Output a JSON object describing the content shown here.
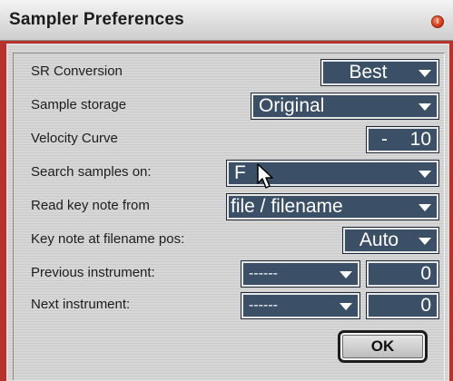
{
  "window": {
    "title": "Sampler Preferences"
  },
  "rows": {
    "sr_conversion": {
      "label": "SR Conversion",
      "value": "Best"
    },
    "sample_storage": {
      "label": "Sample storage",
      "value": "Original"
    },
    "velocity_curve": {
      "label": "Velocity Curve",
      "sign": "-",
      "value": "10"
    },
    "search_samples_on": {
      "label": "Search samples on:",
      "value": "F"
    },
    "read_key_note_from": {
      "label": "Read key note from",
      "value": "file / filename"
    },
    "key_note_pos": {
      "label": "Key note at filename pos:",
      "value": "Auto"
    },
    "previous_instrument": {
      "label": "Previous instrument:",
      "value": "------",
      "number": "0"
    },
    "next_instrument": {
      "label": "Next instrument:",
      "value": "------",
      "number": "0"
    }
  },
  "buttons": {
    "ok": "OK"
  }
}
